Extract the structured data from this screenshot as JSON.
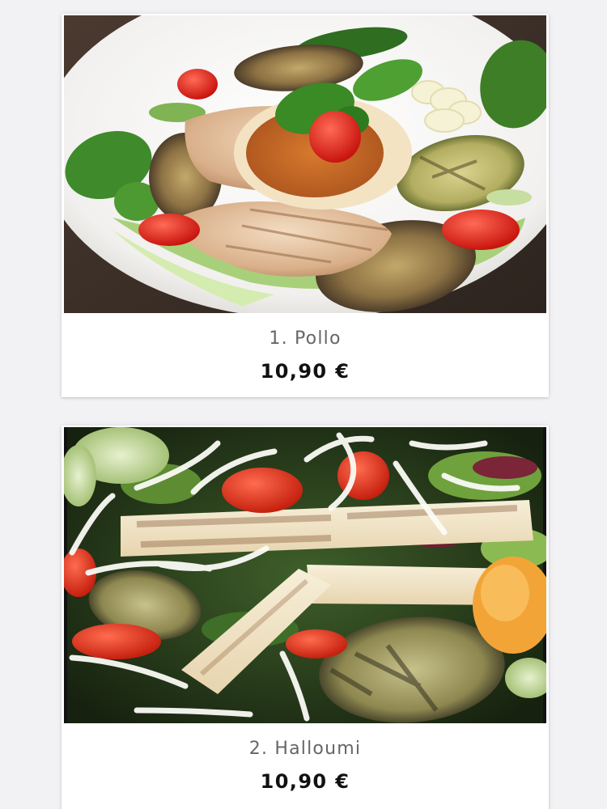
{
  "menu": {
    "items": [
      {
        "name": "1. Pollo",
        "price": "10,90 €"
      },
      {
        "name": "2. Halloumi",
        "price": "10,90 €"
      }
    ]
  },
  "colors": {
    "background": "#f2f1f3",
    "card": "#ffffff",
    "name_text": "#666666",
    "price_text": "#111111"
  }
}
